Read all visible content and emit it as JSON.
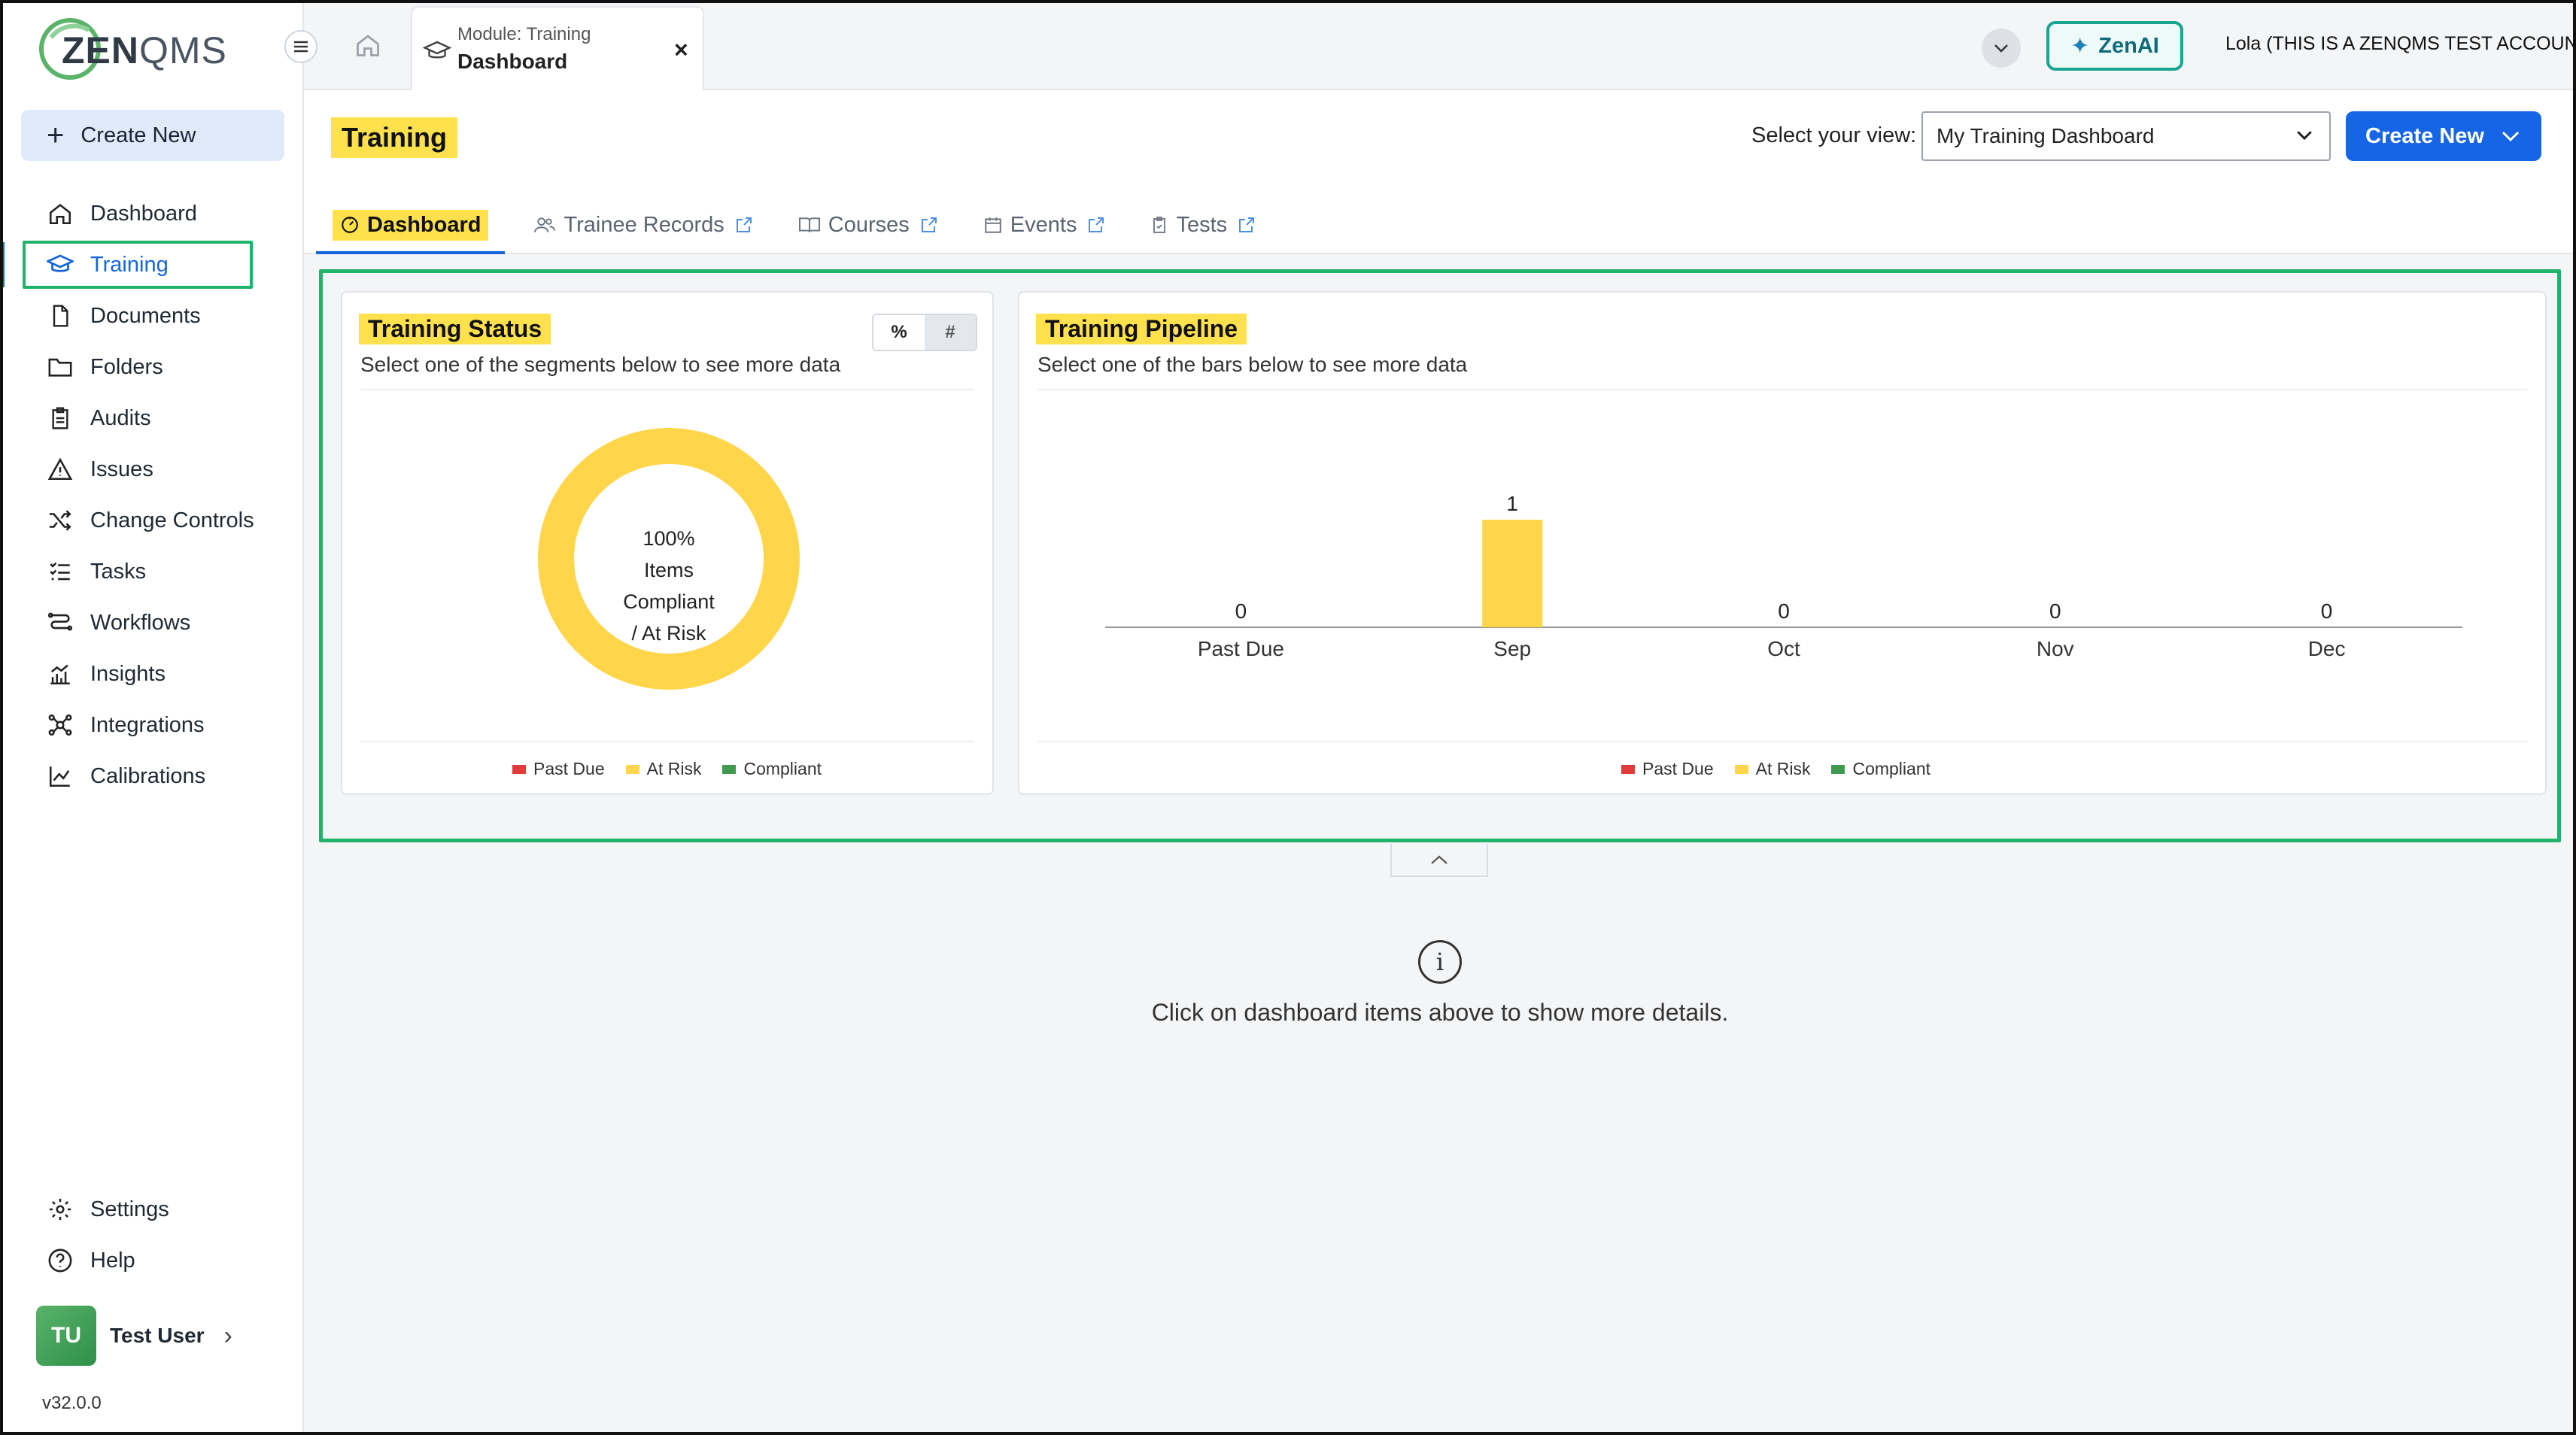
{
  "brand": {
    "logo_text_bold": "ZEN",
    "logo_text_thin": "QMS"
  },
  "sidebar": {
    "create_new": "Create New",
    "items": [
      {
        "label": "Dashboard",
        "icon": "home-icon"
      },
      {
        "label": "Training",
        "icon": "graduation-cap-icon",
        "active": true
      },
      {
        "label": "Documents",
        "icon": "document-icon"
      },
      {
        "label": "Folders",
        "icon": "folder-icon"
      },
      {
        "label": "Audits",
        "icon": "clipboard-icon"
      },
      {
        "label": "Issues",
        "icon": "warning-icon"
      },
      {
        "label": "Change Controls",
        "icon": "shuffle-icon"
      },
      {
        "label": "Tasks",
        "icon": "checklist-icon"
      },
      {
        "label": "Workflows",
        "icon": "workflow-icon"
      },
      {
        "label": "Insights",
        "icon": "chart-icon"
      },
      {
        "label": "Integrations",
        "icon": "network-icon"
      },
      {
        "label": "Calibrations",
        "icon": "line-chart-icon"
      }
    ],
    "bottom_items": [
      {
        "label": "Settings",
        "icon": "gear-icon"
      },
      {
        "label": "Help",
        "icon": "help-icon"
      }
    ],
    "user": {
      "initials": "TU",
      "name": "Test User"
    },
    "version": "v32.0.0"
  },
  "topbar": {
    "module_tab": {
      "caption": "Module: Training",
      "title": "Dashboard",
      "close": "×"
    },
    "zenai": "ZenAI",
    "account": "Lola (THIS IS A ZENQMS TEST ACCOUNT)"
  },
  "page": {
    "title": "Training",
    "view_label": "Select your view:",
    "view_value": "My Training Dashboard",
    "create_new": "Create New",
    "tabs": [
      {
        "label": "Dashboard",
        "icon": "dashboard-gauge-icon",
        "active": true
      },
      {
        "label": "Trainee Records",
        "icon": "users-icon",
        "external": true
      },
      {
        "label": "Courses",
        "icon": "book-icon",
        "external": true
      },
      {
        "label": "Events",
        "icon": "calendar-icon",
        "external": true
      },
      {
        "label": "Tests",
        "icon": "clipboard-check-icon",
        "external": true
      }
    ]
  },
  "status_card": {
    "title": "Training Status",
    "subtitle": "Select one of the segments below to see more data",
    "toggle": [
      "%",
      "#"
    ],
    "center_lines": [
      "100%",
      "Items",
      "Compliant",
      "/ At Risk"
    ]
  },
  "pipeline_card": {
    "title": "Training Pipeline",
    "subtitle": "Select one of the bars below to see more data"
  },
  "legend": [
    {
      "label": "Past Due",
      "color": "#e03b3b"
    },
    {
      "label": "At Risk",
      "color": "#ffd54a"
    },
    {
      "label": "Compliant",
      "color": "#3f9a4f"
    }
  ],
  "info": {
    "text": "Click on dashboard items above to show more details."
  },
  "chart_data": [
    {
      "type": "pie",
      "title": "Training Status",
      "labels": [
        "Past Due",
        "At Risk",
        "Compliant"
      ],
      "values": [
        0,
        100,
        0
      ],
      "center_text": "100% Items Compliant / At Risk"
    },
    {
      "type": "bar",
      "title": "Training Pipeline",
      "categories": [
        "Past Due",
        "Sep",
        "Oct",
        "Nov",
        "Dec"
      ],
      "values": [
        0,
        1,
        0,
        0,
        0
      ],
      "ylim": [
        0,
        1
      ],
      "bar_color": "#ffd54a"
    }
  ]
}
